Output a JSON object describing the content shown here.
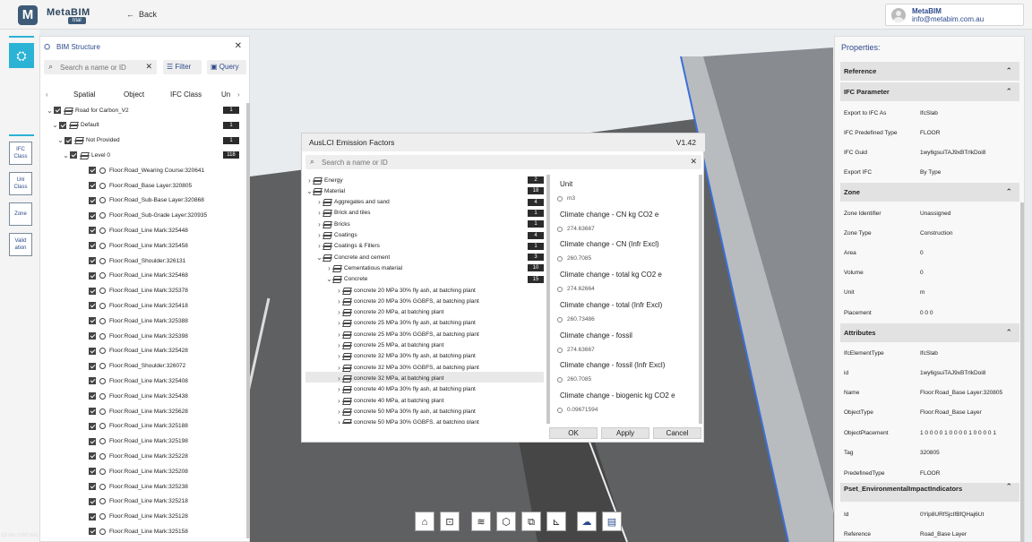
{
  "app": {
    "brand": "MetaBIM",
    "trial": "trial",
    "back_label": "Back"
  },
  "user": {
    "name": "MetaBIM",
    "email": "info@metabim.com.au"
  },
  "left_rail": {
    "buttons": [
      "IFC Class",
      "Uni Class",
      "Zone",
      "Validation"
    ],
    "labels": [
      [
        "IFC",
        "Class"
      ],
      [
        "Uni",
        "Class"
      ],
      [
        "Zone"
      ],
      [
        "Valid",
        "ation"
      ]
    ]
  },
  "bim": {
    "title": "BIM Structure",
    "search_placeholder": "Search a name or ID",
    "filter_label": "Filter",
    "query_label": "Query",
    "tabs": [
      "Spatial",
      "Object",
      "IFC Class",
      "Un"
    ],
    "tree": [
      {
        "label": "Road for Carbon_V2",
        "level": 0,
        "badge": "1",
        "chev": "v"
      },
      {
        "label": "Default",
        "level": 1,
        "badge": "1",
        "chev": "v"
      },
      {
        "label": "Not Provided",
        "level": 2,
        "badge": "1",
        "chev": "v"
      },
      {
        "label": "Level 0",
        "level": 3,
        "badge": "118",
        "chev": "v"
      },
      {
        "label": "Floor:Road_Wearing Course:320641",
        "level": 4
      },
      {
        "label": "Floor:Road_Base Layer:320805",
        "level": 4
      },
      {
        "label": "Floor:Road_Sub-Base Layer:320868",
        "level": 4
      },
      {
        "label": "Floor:Road_Sub-Grade Layer:320935",
        "level": 4
      },
      {
        "label": "Floor:Road_Line Mark:325448",
        "level": 4
      },
      {
        "label": "Floor:Road_Line Mark:325458",
        "level": 4
      },
      {
        "label": "Floor:Road_Shoulder:326131",
        "level": 4
      },
      {
        "label": "Floor:Road_Line Mark:325468",
        "level": 4
      },
      {
        "label": "Floor:Road_Line Mark:325378",
        "level": 4
      },
      {
        "label": "Floor:Road_Line Mark:325418",
        "level": 4
      },
      {
        "label": "Floor:Road_Line Mark:325388",
        "level": 4
      },
      {
        "label": "Floor:Road_Line Mark:325398",
        "level": 4
      },
      {
        "label": "Floor:Road_Line Mark:325428",
        "level": 4
      },
      {
        "label": "Floor:Road_Shoulder:326072",
        "level": 4
      },
      {
        "label": "Floor:Road_Line Mark:325408",
        "level": 4
      },
      {
        "label": "Floor:Road_Line Mark:325438",
        "level": 4
      },
      {
        "label": "Floor:Road_Line Mark:325628",
        "level": 4
      },
      {
        "label": "Floor:Road_Line Mark:325188",
        "level": 4
      },
      {
        "label": "Floor:Road_Line Mark:325198",
        "level": 4
      },
      {
        "label": "Floor:Road_Line Mark:325228",
        "level": 4
      },
      {
        "label": "Floor:Road_Line Mark:325208",
        "level": 4
      },
      {
        "label": "Floor:Road_Line Mark:325238",
        "level": 4
      },
      {
        "label": "Floor:Road_Line Mark:325218",
        "level": 4
      },
      {
        "label": "Floor:Road_Line Mark:325128",
        "level": 4
      },
      {
        "label": "Floor:Road_Line Mark:325158",
        "level": 4
      }
    ]
  },
  "dialog": {
    "title": "AusLCI Emission Factors",
    "version": "V1.42",
    "search_placeholder": "Search a name or ID",
    "tree": [
      {
        "label": "Energy",
        "level": 0,
        "badge": "2",
        "chev": ">"
      },
      {
        "label": "Material",
        "level": 0,
        "badge": "18",
        "chev": "v"
      },
      {
        "label": "Aggregates and sand",
        "level": 1,
        "badge": "4",
        "chev": ">"
      },
      {
        "label": "Brick and tiles",
        "level": 1,
        "badge": "1",
        "chev": ">"
      },
      {
        "label": "Bricks",
        "level": 1,
        "badge": "1",
        "chev": ">"
      },
      {
        "label": "Coatings",
        "level": 1,
        "badge": "4",
        "chev": ">"
      },
      {
        "label": "Coatings & Fillers",
        "level": 1,
        "badge": "1",
        "chev": ">"
      },
      {
        "label": "Concrete and cement",
        "level": 1,
        "badge": "3",
        "chev": "v"
      },
      {
        "label": "Cementatious material",
        "level": 2,
        "badge": "10",
        "chev": ">"
      },
      {
        "label": "Concrete",
        "level": 2,
        "badge": "15",
        "chev": "v"
      },
      {
        "label": "concrete 20 MPa 30% fly ash, at batching plant",
        "level": 3,
        "chev": ">"
      },
      {
        "label": "concrete 20 MPa 30% GGBFS, at batching plant",
        "level": 3,
        "chev": ">"
      },
      {
        "label": "concrete 20 MPa, at batching plant",
        "level": 3,
        "chev": ">"
      },
      {
        "label": "concrete 25 MPa 30% fly ash, at batching plant",
        "level": 3,
        "chev": ">"
      },
      {
        "label": "concrete 25 MPa 30% GGBFS, at batching plant",
        "level": 3,
        "chev": ">"
      },
      {
        "label": "concrete 25 MPa, at batching plant",
        "level": 3,
        "chev": ">"
      },
      {
        "label": "concrete 32 MPa 30% fly ash, at batching plant",
        "level": 3,
        "chev": ">"
      },
      {
        "label": "concrete 32 MPa 30% GGBFS, at batching plant",
        "level": 3,
        "chev": ">"
      },
      {
        "label": "concrete 32 MPa, at batching plant",
        "level": 3,
        "chev": ">"
      },
      {
        "label": "concrete 40 MPa 30% fly ash, at batching plant",
        "level": 3,
        "chev": ">"
      },
      {
        "label": "concrete 40 MPa, at batching plant",
        "level": 3,
        "chev": ">"
      },
      {
        "label": "concrete 50 MPa 30% fly ash, at batching plant",
        "level": 3,
        "chev": ">"
      },
      {
        "label": "concrete 50 MPa 30% GGBFS, at batching plant",
        "level": 3,
        "chev": ">"
      }
    ],
    "details": [
      {
        "label": "Unit",
        "value": "m3"
      },
      {
        "label": "Climate change - CN kg CO2 e",
        "value": "274.63667"
      },
      {
        "label": "Climate change - CN (Infr Excl)",
        "value": "260.7085"
      },
      {
        "label": "Climate change - total kg CO2 e",
        "value": "274.62664"
      },
      {
        "label": "Climate change - total (Infr Excl)",
        "value": "260.73486"
      },
      {
        "label": "Climate change - fossil",
        "value": "274.63667"
      },
      {
        "label": "Climate change - fossil (Infr Excl)",
        "value": "260.7085"
      },
      {
        "label": "Climate change - biogenic kg CO2 e",
        "value": "0.09671594"
      }
    ],
    "ok_label": "OK",
    "apply_label": "Apply",
    "cancel_label": "Cancel"
  },
  "properties": {
    "title": "Properties:",
    "items": [
      {
        "type": "section",
        "label": "Reference"
      },
      {
        "type": "section",
        "label": "IFC Parameter"
      },
      {
        "type": "row",
        "k": "Export to IFC As",
        "v": "IfcSlab"
      },
      {
        "type": "row",
        "k": "IFC Predefined Type",
        "v": "FLOOR"
      },
      {
        "type": "row",
        "k": "IFC Guid",
        "v": "1wy6gsuiTAJ9xBTrlkDoi8"
      },
      {
        "type": "row",
        "k": "Export IFC",
        "v": "By Type"
      },
      {
        "type": "section",
        "label": "Zone"
      },
      {
        "type": "row",
        "k": "Zone Identifier",
        "v": "Unassigned"
      },
      {
        "type": "row",
        "k": "Zone Type",
        "v": "Construction"
      },
      {
        "type": "row",
        "k": "Area",
        "v": "0"
      },
      {
        "type": "row",
        "k": "Volume",
        "v": "0"
      },
      {
        "type": "row",
        "k": "Unit",
        "v": "m"
      },
      {
        "type": "row",
        "k": "Placement",
        "v": "0 0 0"
      },
      {
        "type": "section",
        "label": "Attributes"
      },
      {
        "type": "row",
        "k": "IfcElementType",
        "v": "IfcSlab"
      },
      {
        "type": "row",
        "k": "id",
        "v": "1wy6gsuiTAJ9xBTrlkDoi8"
      },
      {
        "type": "row",
        "k": "Name",
        "v": "Floor:Road_Base Layer:320805"
      },
      {
        "type": "row",
        "k": "ObjectType",
        "v": "Floor:Road_Base Layer"
      },
      {
        "type": "row",
        "k": "ObjectPlacement",
        "v": "1 0 0 0 0 1 0 0 0 0 1 0 0 0 0 1"
      },
      {
        "type": "row",
        "k": "Tag",
        "v": "320805"
      },
      {
        "type": "row",
        "k": "PredefinedType",
        "v": "FLOOR"
      },
      {
        "type": "section",
        "label": "Pset_EnvironmentalImpactIndicators"
      },
      {
        "type": "row",
        "k": "Id",
        "v": "0Yip8URfSjcIfBfQHaj6Ut"
      },
      {
        "type": "row",
        "k": "Reference",
        "v": "Road_Base Layer"
      }
    ]
  },
  "bottom_toolbar": [
    "home-icon",
    "focus-icon",
    "layers-icon",
    "model-icon",
    "copy-icon",
    "measure-icon",
    "cloud-upload-icon",
    "document-icon"
  ],
  "fps": "18 ms (160 ms)"
}
